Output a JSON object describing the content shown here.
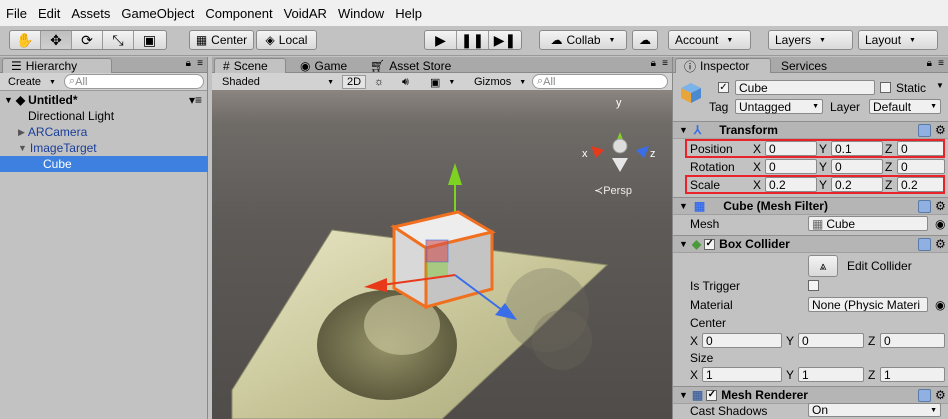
{
  "menu": [
    "File",
    "Edit",
    "Assets",
    "GameObject",
    "Component",
    "VoidAR",
    "Window",
    "Help"
  ],
  "toolbar": {
    "pivot_label": "Center",
    "space_label": "Local",
    "collab_label": "Collab",
    "account_label": "Account",
    "layers_label": "Layers",
    "layout_label": "Layout"
  },
  "hierarchy": {
    "tab": "Hierarchy",
    "create_label": "Create",
    "search_placeholder": "All",
    "scene_name": "Untitled*",
    "items": [
      {
        "label": "Directional Light"
      },
      {
        "label": "ARCamera"
      },
      {
        "label": "ImageTarget"
      },
      {
        "label": "Cube"
      }
    ]
  },
  "scene_panel": {
    "tabs": [
      "Scene",
      "Game",
      "Asset Store"
    ],
    "shading": "Shaded",
    "mode_2d": "2D",
    "gizmos_label": "Gizmos",
    "search_placeholder": "All",
    "persp_label": "Persp",
    "axes": {
      "x": "x",
      "y": "y",
      "z": "z"
    }
  },
  "inspector": {
    "tabs": [
      "Inspector",
      "Services"
    ],
    "object_name": "Cube",
    "static_label": "Static",
    "tag_label": "Tag",
    "tag_value": "Untagged",
    "layer_label": "Layer",
    "layer_value": "Default",
    "transform": {
      "title": "Transform",
      "position": {
        "label": "Position",
        "x": "0",
        "y": "0.1",
        "z": "0"
      },
      "rotation": {
        "label": "Rotation",
        "x": "0",
        "y": "0",
        "z": "0"
      },
      "scale": {
        "label": "Scale",
        "x": "0.2",
        "y": "0.2",
        "z": "0.2"
      }
    },
    "mesh_filter": {
      "title": "Cube (Mesh Filter)",
      "mesh_label": "Mesh",
      "mesh_value": "Cube"
    },
    "box_collider": {
      "title": "Box Collider",
      "edit_label": "Edit Collider",
      "is_trigger_label": "Is Trigger",
      "material_label": "Material",
      "material_value": "None (Physic Materi",
      "center_label": "Center",
      "center": {
        "x": "0",
        "y": "0",
        "z": "0"
      },
      "size_label": "Size",
      "size": {
        "x": "1",
        "y": "1",
        "z": "1"
      }
    },
    "mesh_renderer": {
      "title": "Mesh Renderer",
      "cast_shadows_label": "Cast Shadows",
      "cast_shadows_value": "On"
    },
    "axis_labels": {
      "x": "X",
      "y": "Y",
      "z": "Z"
    }
  },
  "colors": {
    "selection": "#3d80df",
    "highlight_box": "#e8232a",
    "gizmo_x": "#e83a1a",
    "gizmo_y": "#7ed321",
    "gizmo_z": "#3a6ee8",
    "cube_outline": "#f07020"
  }
}
